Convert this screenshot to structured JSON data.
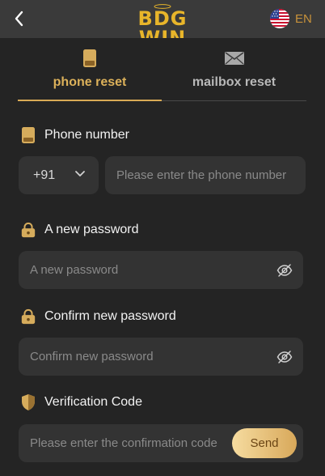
{
  "header": {
    "logo_text": "BDG WIN",
    "language": "EN"
  },
  "tabs": [
    {
      "label": "phone reset",
      "active": true,
      "icon": "phone-icon"
    },
    {
      "label": "mailbox reset",
      "active": false,
      "icon": "mail-icon"
    }
  ],
  "form": {
    "phone": {
      "label": "Phone number",
      "country_code": "+91",
      "placeholder": "Please enter the phone number"
    },
    "new_password": {
      "label": "A new password",
      "placeholder": "A new password"
    },
    "confirm_password": {
      "label": "Confirm new password",
      "placeholder": "Confirm new password"
    },
    "verification": {
      "label": "Verification Code",
      "placeholder": "Please enter the confirmation code",
      "send_label": "Send"
    }
  },
  "colors": {
    "accent_gold": "#d9aa55",
    "logo_gold": "#e8b52a",
    "background": "#242424",
    "header": "#3a3a3a",
    "input_bg": "#333333"
  }
}
